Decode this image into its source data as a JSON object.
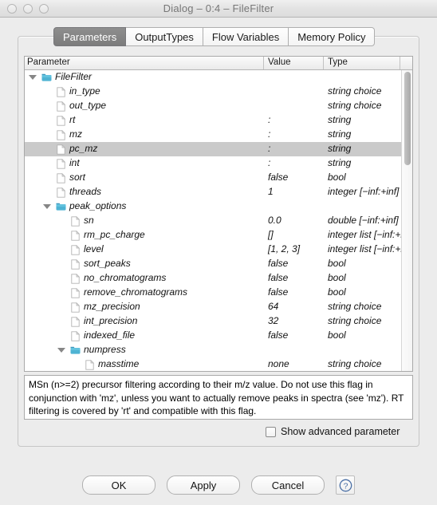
{
  "window": {
    "title": "Dialog – 0:4 – FileFilter",
    "traffic_lights": [
      "close-button",
      "minimize-button",
      "zoom-button"
    ]
  },
  "tabs": [
    {
      "label": "Parameters",
      "active": true
    },
    {
      "label": "OutputTypes",
      "active": false
    },
    {
      "label": "Flow Variables",
      "active": false
    },
    {
      "label": "Memory Policy",
      "active": false
    }
  ],
  "table": {
    "columns": [
      "Parameter",
      "Value",
      "Type"
    ],
    "rows": [
      {
        "name": "FileFilter",
        "value": "",
        "type": "",
        "depth": 0,
        "icon": "folder-icon",
        "expanded": true,
        "selected": false
      },
      {
        "name": "in_type",
        "value": "",
        "type": "string choice",
        "depth": 1,
        "icon": "file-icon",
        "expanded": null,
        "selected": false
      },
      {
        "name": "out_type",
        "value": "",
        "type": "string choice",
        "depth": 1,
        "icon": "file-icon",
        "expanded": null,
        "selected": false
      },
      {
        "name": "rt",
        "value": ":",
        "type": "string",
        "depth": 1,
        "icon": "file-icon",
        "expanded": null,
        "selected": false
      },
      {
        "name": "mz",
        "value": ":",
        "type": "string",
        "depth": 1,
        "icon": "file-icon",
        "expanded": null,
        "selected": false
      },
      {
        "name": "pc_mz",
        "value": ":",
        "type": "string",
        "depth": 1,
        "icon": "file-icon",
        "expanded": null,
        "selected": true
      },
      {
        "name": "int",
        "value": ":",
        "type": "string",
        "depth": 1,
        "icon": "file-icon",
        "expanded": null,
        "selected": false
      },
      {
        "name": "sort",
        "value": "false",
        "type": "bool",
        "depth": 1,
        "icon": "file-icon",
        "expanded": null,
        "selected": false
      },
      {
        "name": "threads",
        "value": "1",
        "type": "integer [−inf:+inf]",
        "depth": 1,
        "icon": "file-icon",
        "expanded": null,
        "selected": false
      },
      {
        "name": "peak_options",
        "value": "",
        "type": "",
        "depth": 1,
        "icon": "folder-icon",
        "expanded": true,
        "selected": false
      },
      {
        "name": "sn",
        "value": "0.0",
        "type": "double [−inf:+inf]",
        "depth": 2,
        "icon": "file-icon",
        "expanded": null,
        "selected": false
      },
      {
        "name": "rm_pc_charge",
        "value": "[]",
        "type": "integer list [−inf:+inf]",
        "depth": 2,
        "icon": "file-icon",
        "expanded": null,
        "selected": false
      },
      {
        "name": "level",
        "value": "[1, 2, 3]",
        "type": "integer list [−inf:+inf]",
        "depth": 2,
        "icon": "file-icon",
        "expanded": null,
        "selected": false
      },
      {
        "name": "sort_peaks",
        "value": "false",
        "type": "bool",
        "depth": 2,
        "icon": "file-icon",
        "expanded": null,
        "selected": false
      },
      {
        "name": "no_chromatograms",
        "value": "false",
        "type": "bool",
        "depth": 2,
        "icon": "file-icon",
        "expanded": null,
        "selected": false
      },
      {
        "name": "remove_chromatograms",
        "value": "false",
        "type": "bool",
        "depth": 2,
        "icon": "file-icon",
        "expanded": null,
        "selected": false
      },
      {
        "name": "mz_precision",
        "value": "64",
        "type": "string choice",
        "depth": 2,
        "icon": "file-icon",
        "expanded": null,
        "selected": false
      },
      {
        "name": "int_precision",
        "value": "32",
        "type": "string choice",
        "depth": 2,
        "icon": "file-icon",
        "expanded": null,
        "selected": false
      },
      {
        "name": "indexed_file",
        "value": "false",
        "type": "bool",
        "depth": 2,
        "icon": "file-icon",
        "expanded": null,
        "selected": false
      },
      {
        "name": "numpress",
        "value": "",
        "type": "",
        "depth": 2,
        "icon": "folder-icon",
        "expanded": true,
        "selected": false
      },
      {
        "name": "masstime",
        "value": "none",
        "type": "string choice",
        "depth": 3,
        "icon": "file-icon",
        "expanded": null,
        "selected": false
      }
    ]
  },
  "description": {
    "text": "MSn (n>=2) precursor filtering according to their m/z value. Do not use this flag in conjunction with 'mz', unless you want to actually remove peaks in spectra (see 'mz'). RT filtering is covered by 'rt' and compatible with this flag."
  },
  "advanced": {
    "label": "Show advanced parameter",
    "checked": false
  },
  "footer": {
    "ok_label": "OK",
    "apply_label": "Apply",
    "cancel_label": "Cancel",
    "help_label": "?"
  },
  "colors": {
    "folder": "#4eb3d3",
    "selection": "#cacaca",
    "title_text": "#777777",
    "active_tab_bg": "#7c7c7c",
    "help_blue": "#4a6fa5"
  }
}
